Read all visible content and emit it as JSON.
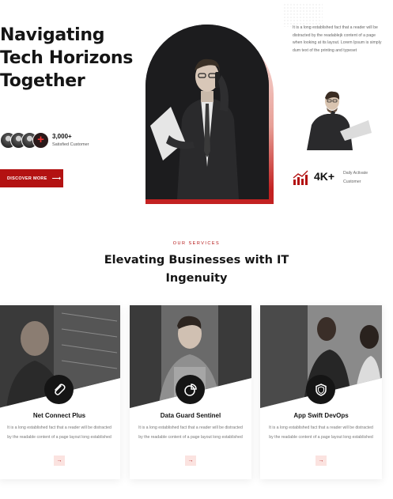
{
  "hero": {
    "title_lines": [
      "Navigating",
      "Tech Horizons",
      "Together"
    ],
    "customers_count": "3,000+",
    "customers_label": "Satisfied Customer",
    "cta_label": "DISCOVER MORE",
    "cta_arrow": "⟶"
  },
  "aside": {
    "description": "It is a long established fact that a reader will be distracted by the readablejk content of a page when looking at its layout. Lorem Ipsum is simply dum text of the printing and typeset",
    "kpi_value": "4K+",
    "kpi_label": "Daily Activate Customer"
  },
  "services": {
    "eyebrow": "OUR SERVICES",
    "title": "Elevating Businesses with IT Ingenuity",
    "cards": [
      {
        "title": "Net Connect Plus",
        "text": "It is a long established fact that a reader will be distracted by the readable content of a page layout long established",
        "icon": "paperclip-icon",
        "arrow": "→"
      },
      {
        "title": "Data Guard Sentinel",
        "text": "It is a long established fact that a reader will be distracted by the readable content of a page layout long established",
        "icon": "pie-chart-icon",
        "arrow": "→"
      },
      {
        "title": "App Swift DevOps",
        "text": "It is a long established fact that a reader will be distracted by the readable content of a page layout long established",
        "icon": "shield-icon",
        "arrow": "→"
      }
    ]
  },
  "colors": {
    "accent": "#b31212",
    "dark": "#151515",
    "muted": "#777777"
  }
}
